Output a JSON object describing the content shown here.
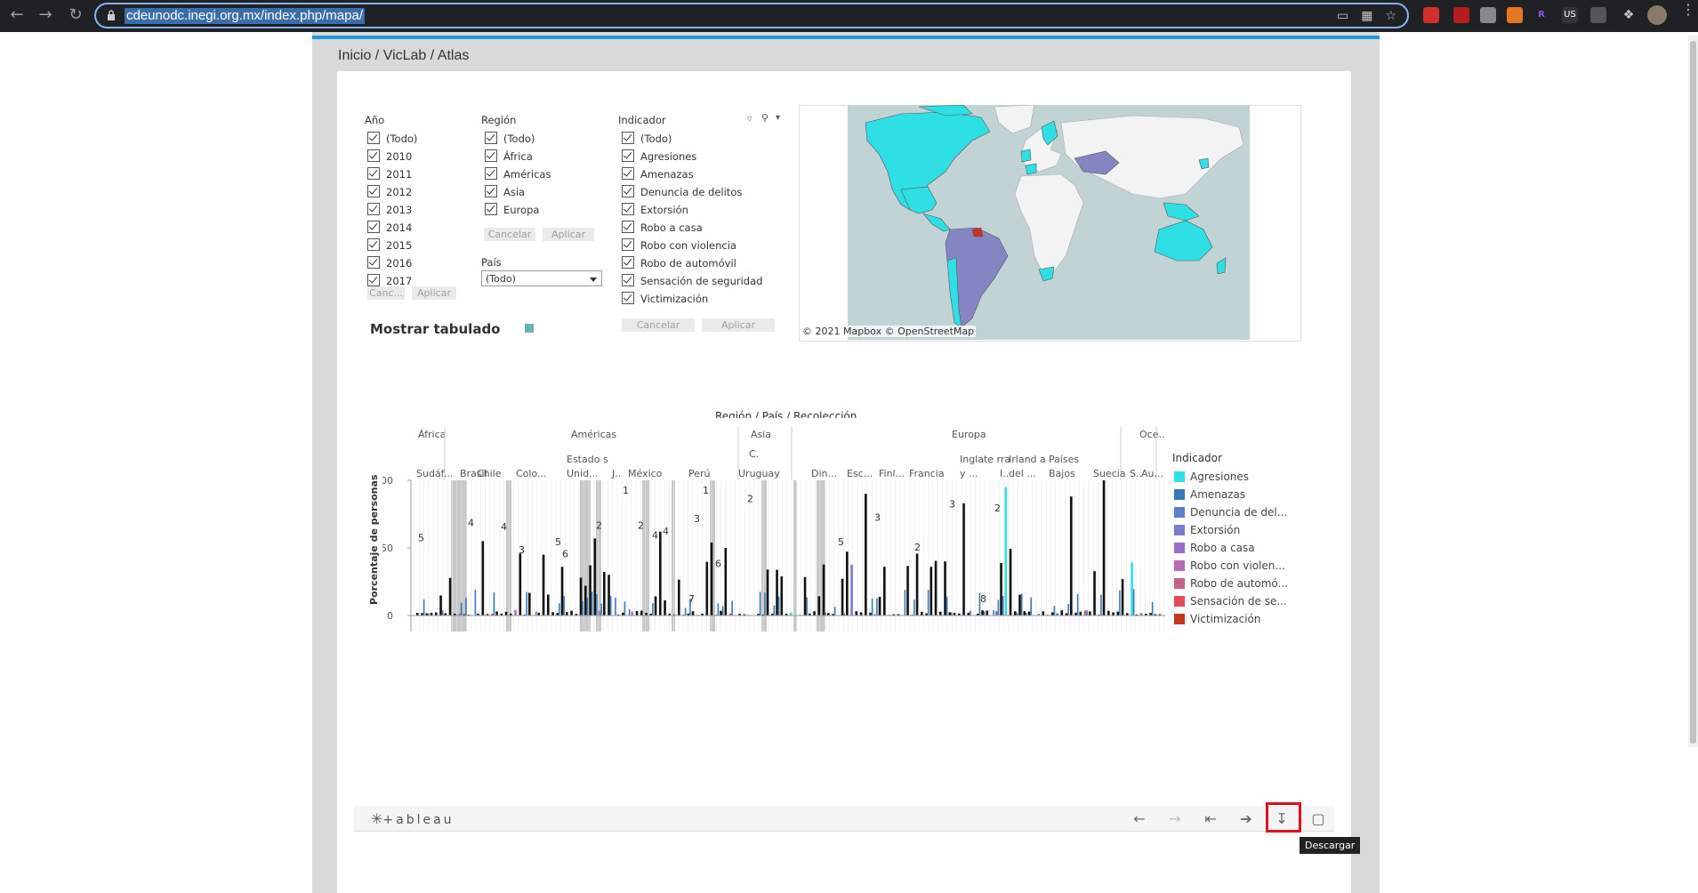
{
  "browser": {
    "url": "cdeunodc.inegi.org.mx/index.php/mapa/",
    "ext_label": "US"
  },
  "breadcrumb": "Inicio / VicLab / Atlas",
  "filters": {
    "anio": {
      "title": "Año",
      "items": [
        "(Todo)",
        "2010",
        "2011",
        "2012",
        "2013",
        "2014",
        "2015",
        "2016",
        "2017"
      ],
      "cancel": "Canc...",
      "apply": "Aplicar"
    },
    "region": {
      "title": "Región",
      "items": [
        "(Todo)",
        "África",
        "Américas",
        "Asia",
        "Europa"
      ],
      "cancel": "Cancelar",
      "apply": "Aplicar"
    },
    "pais": {
      "title": "País",
      "value": "(Todo)"
    },
    "indicador": {
      "title": "Indicador",
      "items": [
        "(Todo)",
        "Agresiones",
        "Amenazas",
        "Denuncia de delitos",
        "Extorsión",
        "Robo a casa",
        "Robo con violencia",
        "Robo de automóvil",
        "Sensación de seguridad",
        "Victimización"
      ],
      "cancel": "Cancelar",
      "apply": "Aplicar"
    }
  },
  "mostrar_tabulado": "Mostrar tabulado",
  "map": {
    "credit": "© 2021 Mapbox © OpenStreetMap",
    "colors": {
      "ocean": "#c2d3d6",
      "land": "#f3f3f3",
      "cyan": "#2ee0e6",
      "purple": "#8585c4"
    }
  },
  "chart_data": {
    "type": "bar",
    "title": "Región / País / Recolección",
    "ylabel": "Porcentaje de personas",
    "yticks": [
      "100",
      "50",
      "0"
    ],
    "ylim": [
      0,
      100
    ],
    "regions": [
      "África",
      "Américas",
      "Asia",
      "Europa",
      "Oce.."
    ],
    "region_ticks": [
      "C."
    ],
    "countries": [
      "Sudáf...",
      "Brasil",
      "Chile",
      "Colo...",
      "Estado s Unid...",
      "J..",
      "México",
      "Perú",
      "Uruguay",
      "Din...",
      "Esc...",
      "Finl...",
      "Francia",
      "Inglate rra y ...",
      "I..",
      "Irland a del ...",
      "Países Bajos",
      "Suecia",
      "S..",
      "Au..."
    ],
    "data_labels": [
      "5",
      "4",
      "4",
      "3",
      "5",
      "6",
      "2",
      "1",
      "2",
      "4",
      "4",
      "7",
      "3",
      "1",
      "6",
      "2",
      "5",
      "3",
      "2",
      "3",
      "8",
      "2"
    ],
    "series": [
      {
        "name": "Agresiones",
        "color": "#2ee0e6"
      },
      {
        "name": "Amenazas",
        "color": "#3b78b8"
      },
      {
        "name": "Denuncia de del...",
        "color": "#5b7fcc"
      },
      {
        "name": "Extorsión",
        "color": "#7c7cc8"
      },
      {
        "name": "Robo a casa",
        "color": "#9b6fc8"
      },
      {
        "name": "Robo con violen...",
        "color": "#b86cb8"
      },
      {
        "name": "Robo de automó...",
        "color": "#c9608a"
      },
      {
        "name": "Sensación de se...",
        "color": "#e04a5a"
      },
      {
        "name": "Victimización",
        "color": "#c8351e"
      }
    ],
    "legend_title": "Indicador"
  },
  "toolbar": {
    "logo": "+ableau",
    "tooltip": "Descargar"
  }
}
